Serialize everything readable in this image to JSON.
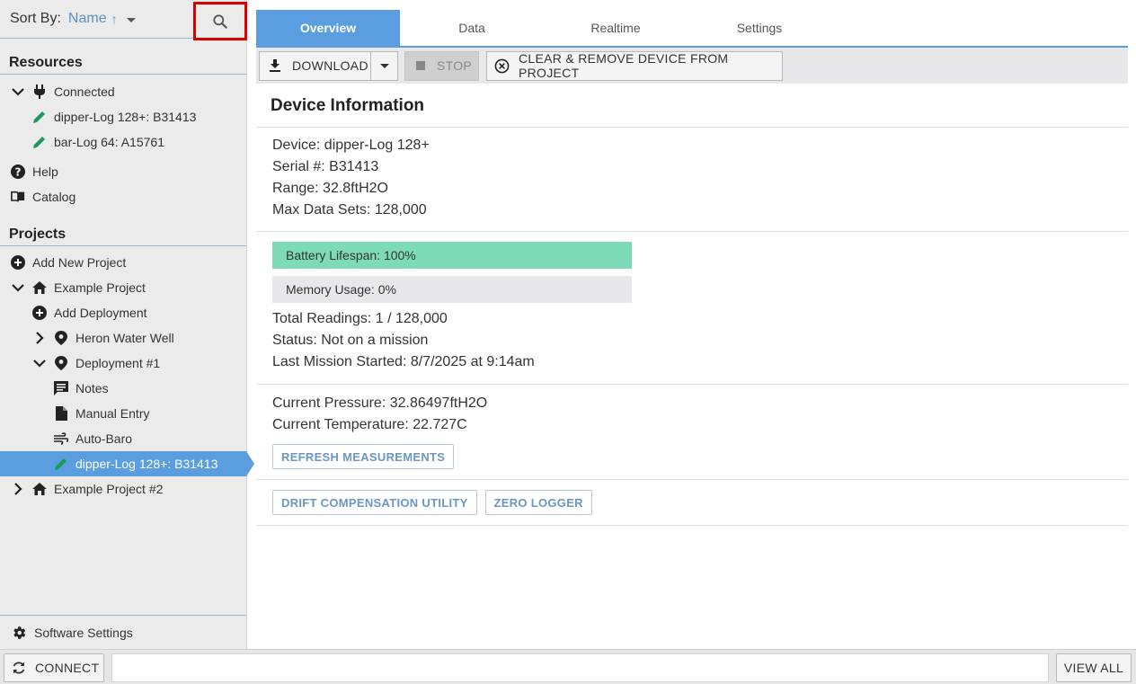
{
  "sidebar": {
    "sort_label": "Sort By:",
    "sort_value": "Name",
    "sort_direction_arrow": "↑",
    "resources_title": "Resources",
    "connected_label": "Connected",
    "devices": [
      {
        "label": "dipper-Log 128+: B31413"
      },
      {
        "label": "bar-Log 64: A15761"
      }
    ],
    "help_label": "Help",
    "catalog_label": "Catalog",
    "projects_title": "Projects",
    "add_new_project_label": "Add New Project",
    "project1": {
      "label": "Example Project",
      "add_deployment_label": "Add Deployment",
      "heron_label": "Heron Water Well",
      "deployment_label": "Deployment #1",
      "notes_label": "Notes",
      "manual_entry_label": "Manual Entry",
      "auto_baro_label": "Auto-Baro",
      "selected_device_label": "dipper-Log 128+: B31413"
    },
    "project2_label": "Example Project #2",
    "software_settings_label": "Software Settings"
  },
  "tabs": [
    {
      "label": "Overview",
      "active": true
    },
    {
      "label": "Data",
      "active": false
    },
    {
      "label": "Realtime",
      "active": false
    },
    {
      "label": "Settings",
      "active": false
    }
  ],
  "toolbar": {
    "download_label": "DOWNLOAD",
    "stop_label": "STOP",
    "clear_label": "CLEAR & REMOVE DEVICE FROM PROJECT"
  },
  "device_info": {
    "title": "Device Information",
    "device": "Device: dipper-Log 128+",
    "serial": "Serial #: B31413",
    "range": "Range: 32.8ftH2O",
    "max_data_sets": "Max Data Sets: 128,000",
    "battery_label": "Battery Lifespan: 100%",
    "battery_level": 1.0,
    "memory_label": "Memory Usage: 0%",
    "memory_level": 0.0,
    "total_readings": "Total Readings: 1 / 128,000",
    "status": "Status: Not on a mission",
    "last_mission": "Last Mission Started: 8/7/2025 at 9:14am",
    "current_pressure": "Current Pressure: 32.86497ftH2O",
    "current_temperature": "Current Temperature: 22.727C",
    "refresh_label": "REFRESH MEASUREMENTS",
    "drift_label": "DRIFT COMPENSATION UTILITY",
    "zero_label": "ZERO LOGGER"
  },
  "bottom": {
    "connect_label": "CONNECT",
    "view_all_label": "VIEW ALL"
  },
  "colors": {
    "accent": "#5a9ee0",
    "battery_fill": "#7ddbb9",
    "device_icon": "#1a9a5a",
    "highlight_border": "#dd0000"
  }
}
